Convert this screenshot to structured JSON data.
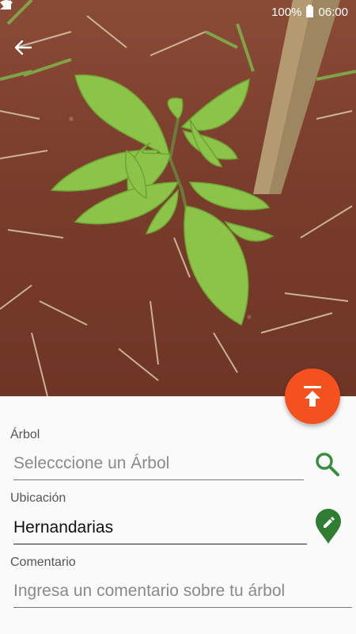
{
  "status_bar": {
    "battery_text": "100%",
    "time": "06:00"
  },
  "header": {
    "back_icon": "arrow-left-icon"
  },
  "fab": {
    "icon": "upload-icon",
    "color": "#f4511e"
  },
  "form": {
    "tree": {
      "label": "Árbol",
      "placeholder": "Selecccione un Árbol",
      "action_icon": "search-icon",
      "icon_color": "#388e3c"
    },
    "location": {
      "label": "Ubicación",
      "value": "Hernandarias",
      "action_icon": "map-pin-edit-icon",
      "icon_color": "#2e7d32"
    },
    "comment": {
      "label": "Comentario",
      "placeholder": "Ingresa un comentario sobre tu árbol"
    }
  }
}
